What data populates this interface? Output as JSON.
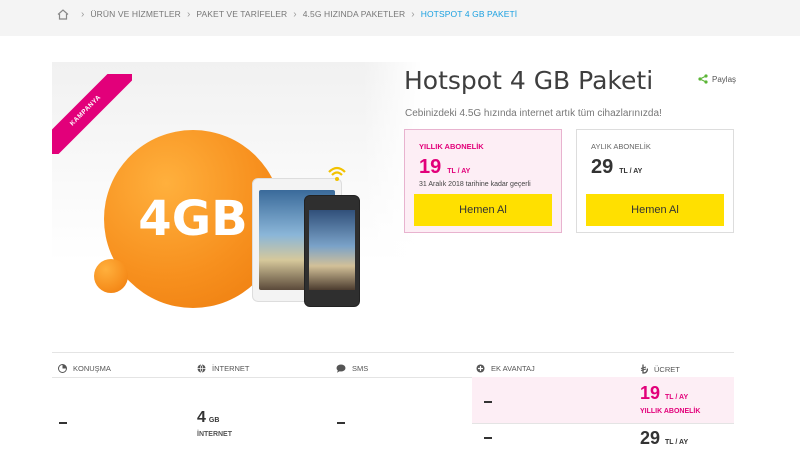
{
  "breadcrumb": {
    "items": [
      "ÜRÜN VE HİZMETLER",
      "PAKET VE TARİFELER",
      "4.5G HIZINDA PAKETLER",
      "HOTSPOT 4 GB PAKETİ"
    ]
  },
  "hero": {
    "ribbon": "KAMPANYA",
    "badge": "4GB"
  },
  "product": {
    "title": "Hotspot 4 GB Paketi",
    "share_label": "Paylaş",
    "subtitle": "Cebinizdeki 4.5G hızında internet artık tüm cihazlarınızda!"
  },
  "plans": {
    "yearly": {
      "label": "YILLIK ABONELİK",
      "price": "19",
      "unit": "TL / AY",
      "validity": "31 Aralık 2018 tarihine kadar geçerli",
      "button": "Hemen Al"
    },
    "monthly": {
      "label": "AYLIK ABONELİK",
      "price": "29",
      "unit": "TL / AY",
      "button": "Hemen Al"
    }
  },
  "table": {
    "headers": [
      "KONUŞMA",
      "İNTERNET",
      "SMS",
      "EK AVANTAJ",
      "ÜCRET"
    ],
    "internet_value": "4",
    "internet_unit": "GB",
    "internet_label": "İNTERNET",
    "fee_yearly_price": "19",
    "fee_yearly_unit": "TL / AY",
    "fee_yearly_label": "YILLIK ABONELİK",
    "fee_monthly_price": "29",
    "fee_monthly_unit": "TL / AY"
  },
  "colors": {
    "accent_pink": "#e2007a",
    "button_yellow": "#ffe000",
    "link_blue": "#1aa0e0",
    "orange": "#f7901e"
  }
}
